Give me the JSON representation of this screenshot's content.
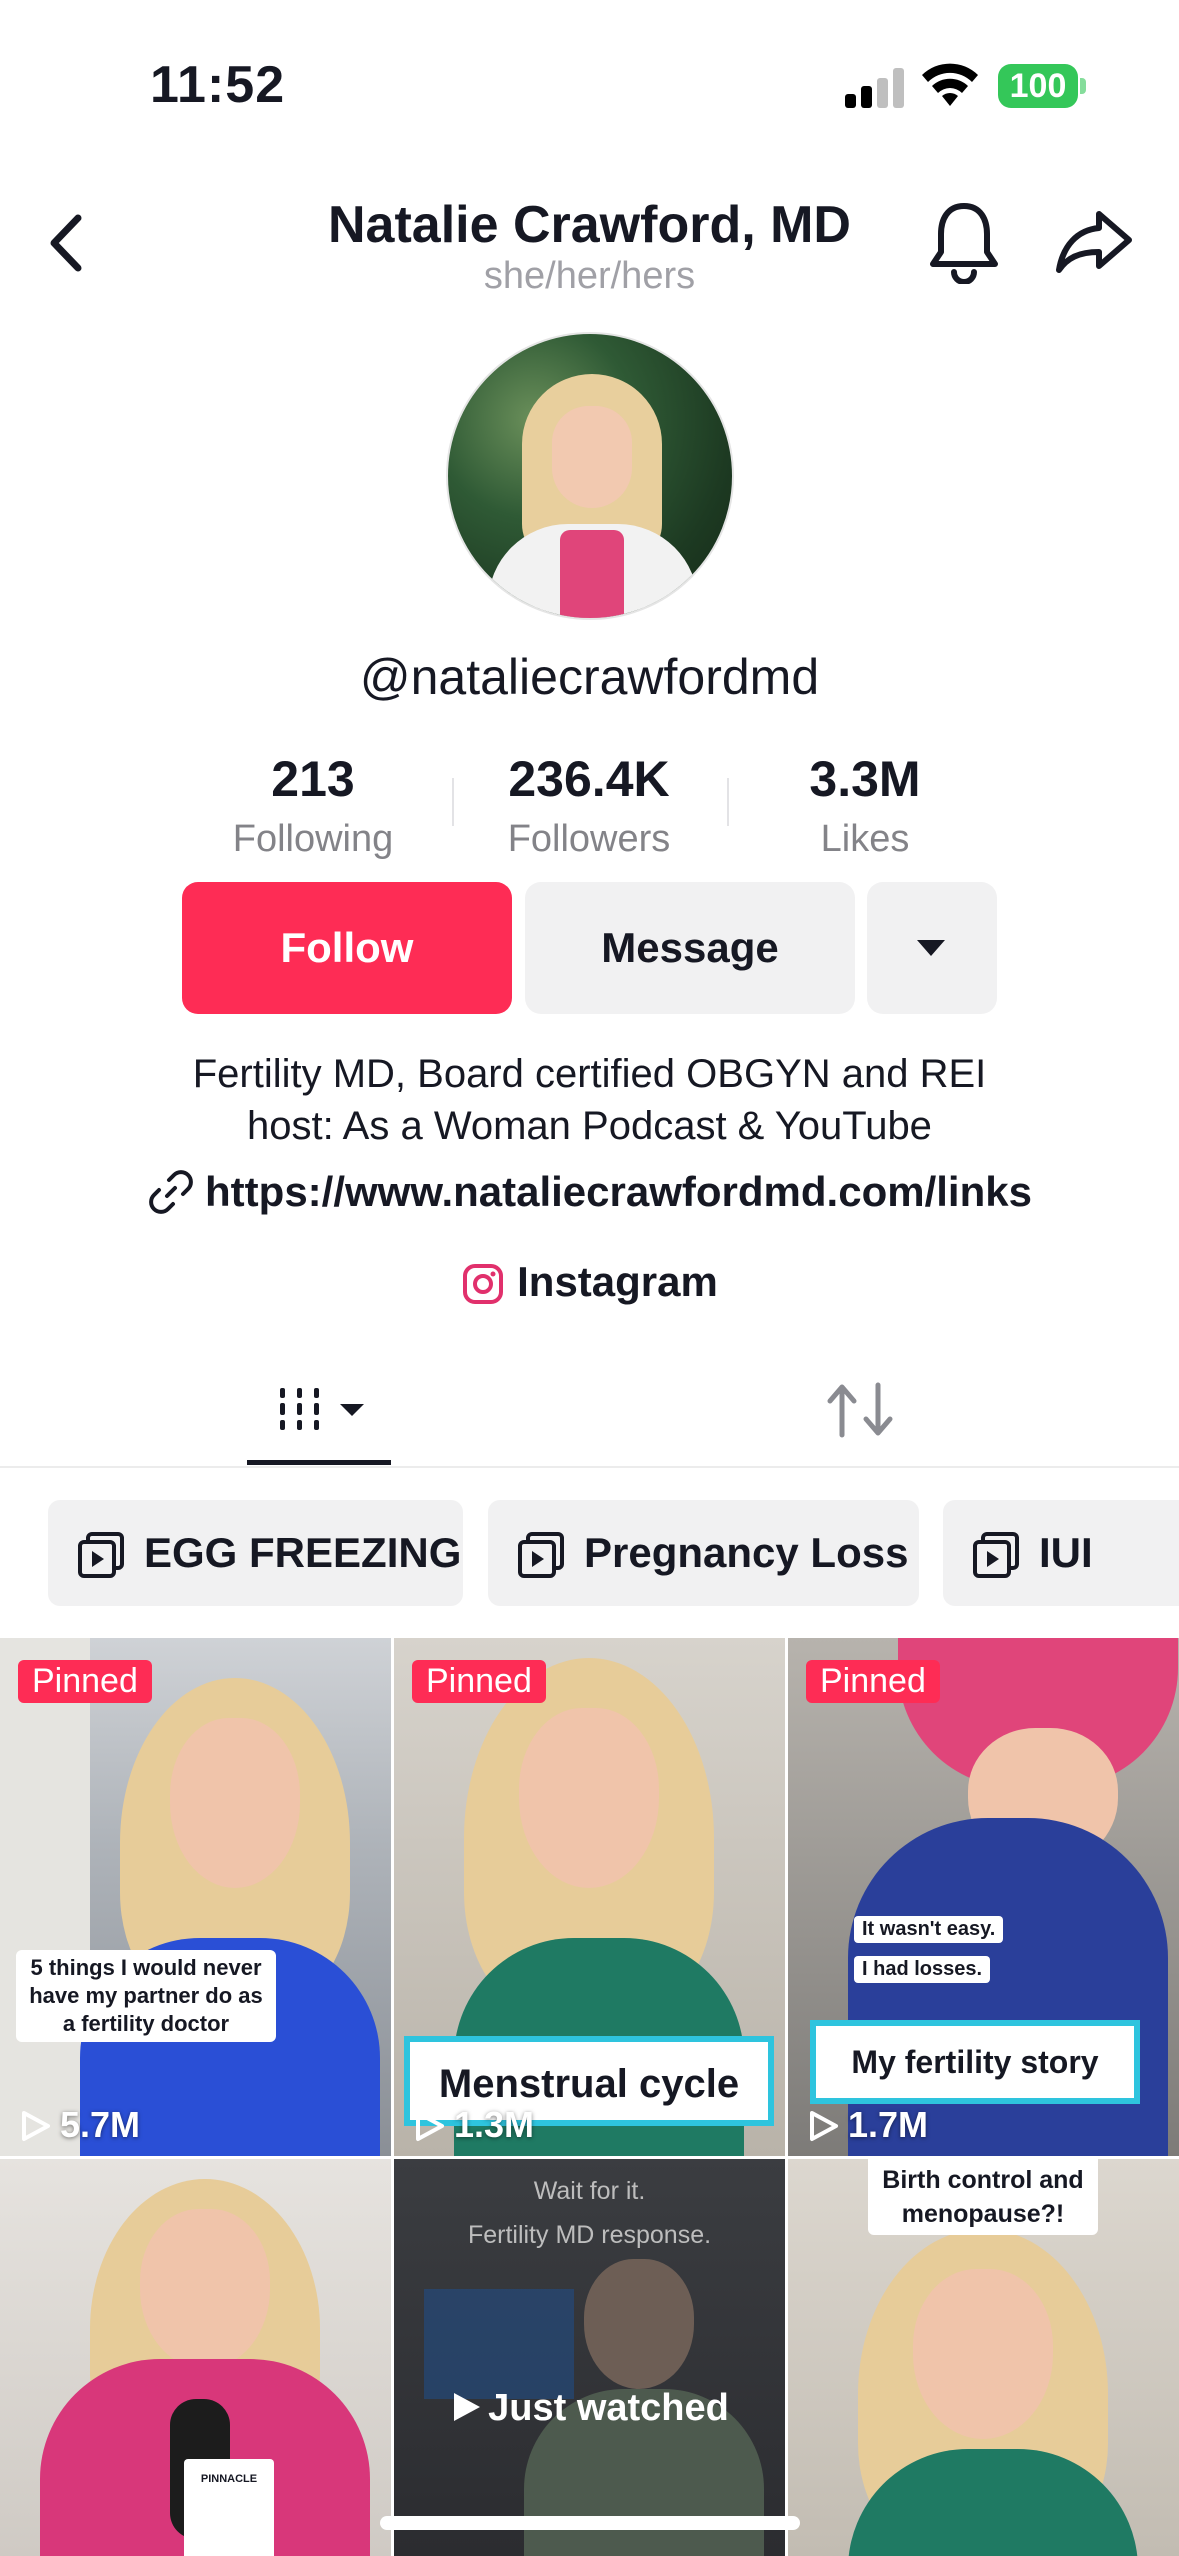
{
  "status_bar": {
    "time": "11:52",
    "battery": "100"
  },
  "header": {
    "title": "Natalie Crawford, MD",
    "pronouns": "she/her/hers"
  },
  "profile": {
    "username": "@nataliecrawfordmd",
    "stats": [
      {
        "value": "213",
        "label": "Following"
      },
      {
        "value": "236.4K",
        "label": "Followers"
      },
      {
        "value": "3.3M",
        "label": "Likes"
      }
    ],
    "follow_label": "Follow",
    "message_label": "Message",
    "bio_line1": "Fertility MD, Board certified OBGYN and REI",
    "bio_line2": "host: As a Woman Podcast & YouTube",
    "link": "https://www.nataliecrawfordmd.com/links",
    "instagram": "Instagram"
  },
  "colors": {
    "accent": "#fe2c55",
    "secondary_button": "#f1f1f2",
    "battery": "#34c759"
  },
  "playlists": [
    {
      "label": "EGG FREEZING"
    },
    {
      "label": "Pregnancy Loss"
    },
    {
      "label": "IUI"
    }
  ],
  "videos": [
    {
      "pinned": "Pinned",
      "views": "5.7M",
      "caption": "5 things I would never have my partner do as a fertility doctor"
    },
    {
      "pinned": "Pinned",
      "views": "1.3M",
      "caption": "Menstrual cycle"
    },
    {
      "pinned": "Pinned",
      "views": "1.7M",
      "caption_top1": "It wasn't easy.",
      "caption_top2": "I had losses.",
      "caption": "My fertility story"
    },
    {
      "mic_label": "PINNACLE"
    },
    {
      "caption_top1": "Wait for it.",
      "caption_top2": "Fertility MD response.",
      "just_watched": "Just watched"
    },
    {
      "caption": "Birth control and menopause?!"
    }
  ]
}
